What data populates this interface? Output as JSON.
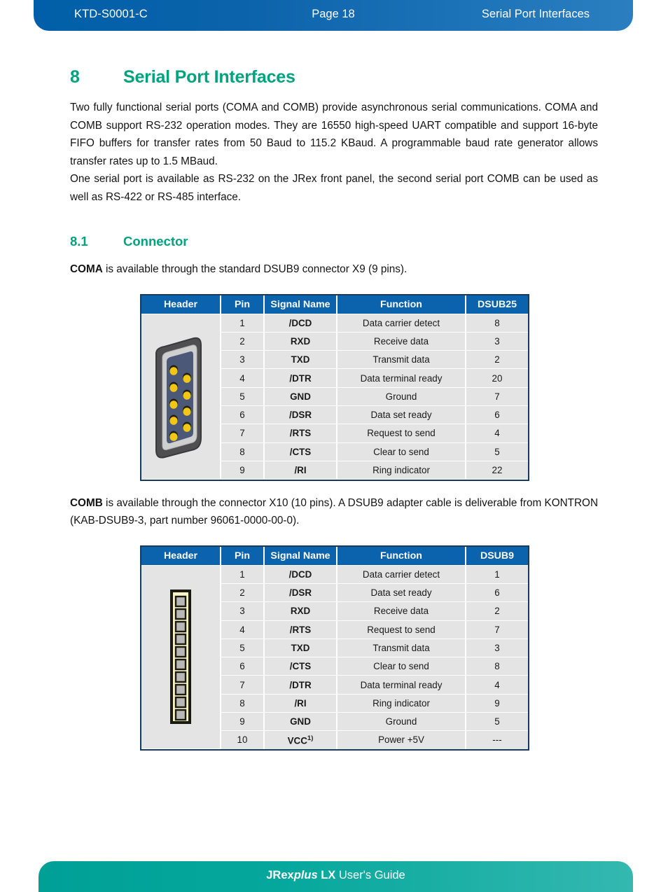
{
  "header": {
    "doc_id": "KTD-S0001-C",
    "page_label": "Page 18",
    "section_label": "Serial Port Interfaces",
    "bar_color": "#0a63ac"
  },
  "footer": {
    "title_bold": "JRex",
    "title_italic": "plus",
    "title_bold2": " LX",
    "title_rest": " User's Guide",
    "bar_color": "#00a097"
  },
  "section": {
    "number": "8",
    "title": "Serial Port Interfaces",
    "heading_color": "#00a37e",
    "paragraph_1": "Two fully functional serial ports (COMA and COMB) provide asynchronous serial communications. COMA and COMB support RS-232 operation modes. They are 16550 high-speed UART compatible and support 16-byte FIFO buffers for transfer rates from 50 Baud to 115.2 KBaud. A programmable baud rate generator allows transfer rates up to 1.5 MBaud.",
    "paragraph_2": "One serial port is available as RS-232 on the JRex front panel, the second serial port COMB can be used as well as RS-422 or RS-485 interface."
  },
  "subsection": {
    "number": "8.1",
    "title": "Connector",
    "coma_lead": "COMA",
    "coma_text": " is available through the standard DSUB9 connector X9 (9 pins).",
    "comb_lead": "COMB",
    "comb_text": " is available through the connector X10 (10 pins). A DSUB9 adapter cable is deliverable from KONTRON (KAB-DSUB9-3, part number 96061-0000-00-0)."
  },
  "table_coma": {
    "columns": [
      "Header",
      "Pin",
      "Signal Name",
      "Function",
      "DSUB25"
    ],
    "connector_type": "dsub9-connector",
    "rows": [
      {
        "pin": "1",
        "signal": "/DCD",
        "function": "Data carrier detect",
        "dsub": "8"
      },
      {
        "pin": "2",
        "signal": "RXD",
        "function": "Receive data",
        "dsub": "3"
      },
      {
        "pin": "3",
        "signal": "TXD",
        "function": "Transmit data",
        "dsub": "2"
      },
      {
        "pin": "4",
        "signal": "/DTR",
        "function": "Data terminal ready",
        "dsub": "20"
      },
      {
        "pin": "5",
        "signal": "GND",
        "function": "Ground",
        "dsub": "7"
      },
      {
        "pin": "6",
        "signal": "/DSR",
        "function": "Data set ready",
        "dsub": "6"
      },
      {
        "pin": "7",
        "signal": "/RTS",
        "function": "Request to send",
        "dsub": "4"
      },
      {
        "pin": "8",
        "signal": "/CTS",
        "function": "Clear to send",
        "dsub": "5"
      },
      {
        "pin": "9",
        "signal": "/RI",
        "function": "Ring indicator",
        "dsub": "22"
      }
    ]
  },
  "table_comb": {
    "columns": [
      "Header",
      "Pin",
      "Signal Name",
      "Function",
      "DSUB9"
    ],
    "connector_type": "pin-header-10",
    "rows": [
      {
        "pin": "1",
        "signal": "/DCD",
        "sup": "",
        "function": "Data carrier detect",
        "dsub": "1"
      },
      {
        "pin": "2",
        "signal": "/DSR",
        "sup": "",
        "function": "Data set ready",
        "dsub": "6"
      },
      {
        "pin": "3",
        "signal": "RXD",
        "sup": "",
        "function": "Receive data",
        "dsub": "2"
      },
      {
        "pin": "4",
        "signal": "/RTS",
        "sup": "",
        "function": "Request to send",
        "dsub": "7"
      },
      {
        "pin": "5",
        "signal": "TXD",
        "sup": "",
        "function": "Transmit data",
        "dsub": "3"
      },
      {
        "pin": "6",
        "signal": "/CTS",
        "sup": "",
        "function": "Clear to send",
        "dsub": "8"
      },
      {
        "pin": "7",
        "signal": "/DTR",
        "sup": "",
        "function": "Data terminal ready",
        "dsub": "4"
      },
      {
        "pin": "8",
        "signal": "/RI",
        "sup": "",
        "function": "Ring indicator",
        "dsub": "9"
      },
      {
        "pin": "9",
        "signal": "GND",
        "sup": "",
        "function": "Ground",
        "dsub": "5"
      },
      {
        "pin": "10",
        "signal": "VCC",
        "sup": "1)",
        "function": "Power +5V",
        "dsub": "---"
      }
    ]
  }
}
